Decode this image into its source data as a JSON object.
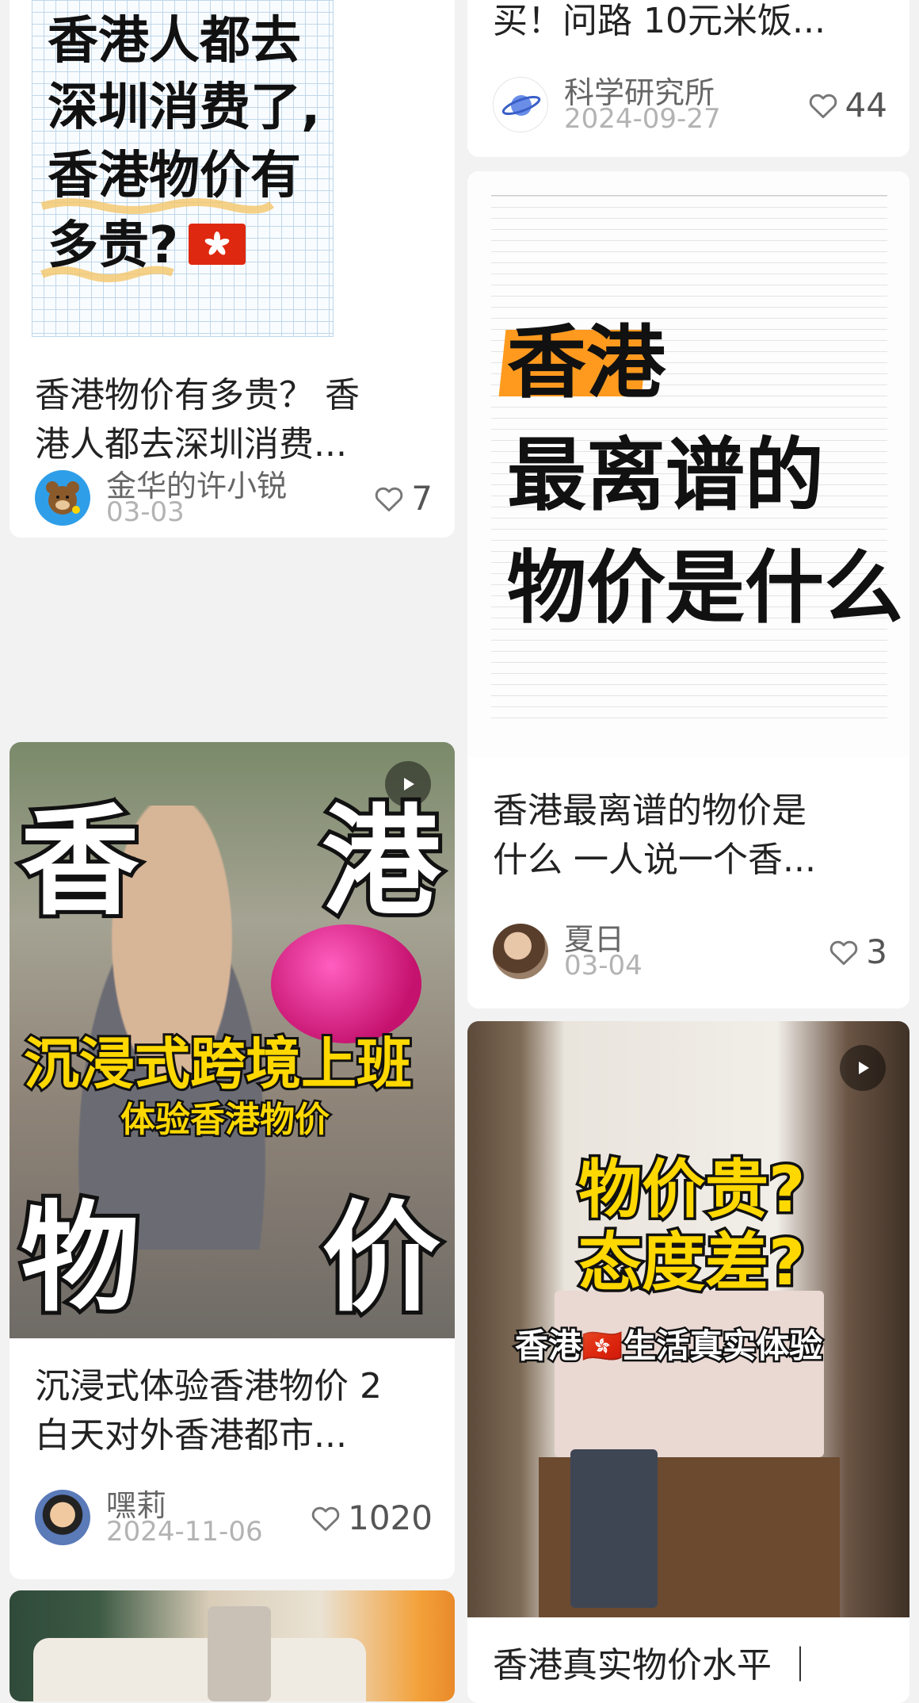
{
  "cards": [
    {
      "cover_lines": [
        "香港人都去",
        "深圳消费了,",
        "香港物价有",
        "多贵?"
      ],
      "title_line1": "香港物价有多贵？ 香",
      "title_line2": "港人都去深圳消费...",
      "author": "金华的许小锐",
      "date": "03-03",
      "likes": "7"
    },
    {
      "title_line1": "买！问路 10元米饭...",
      "author": "科学研究所",
      "date": "2024-09-27",
      "likes": "44"
    },
    {
      "cover_lines": [
        "香港",
        "最离谱的",
        "物价是什么"
      ],
      "title_line1": "香港最离谱的物价是",
      "title_line2": "什么 一人说一个香...",
      "author": "夏日",
      "date": "03-04",
      "likes": "3"
    },
    {
      "cover_chars": [
        "香",
        "港",
        "物",
        "价"
      ],
      "cover_banner": "沉浸式跨境上班",
      "cover_sub": "体验香港物价",
      "title_line1": "沉浸式体验香港物价 2",
      "title_line2": "白天对外香港都市...",
      "author": "嘿莉",
      "date": "2024-11-06",
      "likes": "1020"
    },
    {
      "cover_q1": "物价贵?",
      "cover_q2": "态度差?",
      "cover_banner": "香港🇭🇰生活真实体验",
      "title_line1": "香港真实物价水平 ｜"
    }
  ],
  "colors": {
    "accent_orange": "#ff9a1f",
    "yellow_text": "#ffd800",
    "background": "#f2f2f2"
  },
  "icons": [
    "heart-icon",
    "play-icon",
    "planet-avatar-icon",
    "hk-flag-icon"
  ]
}
